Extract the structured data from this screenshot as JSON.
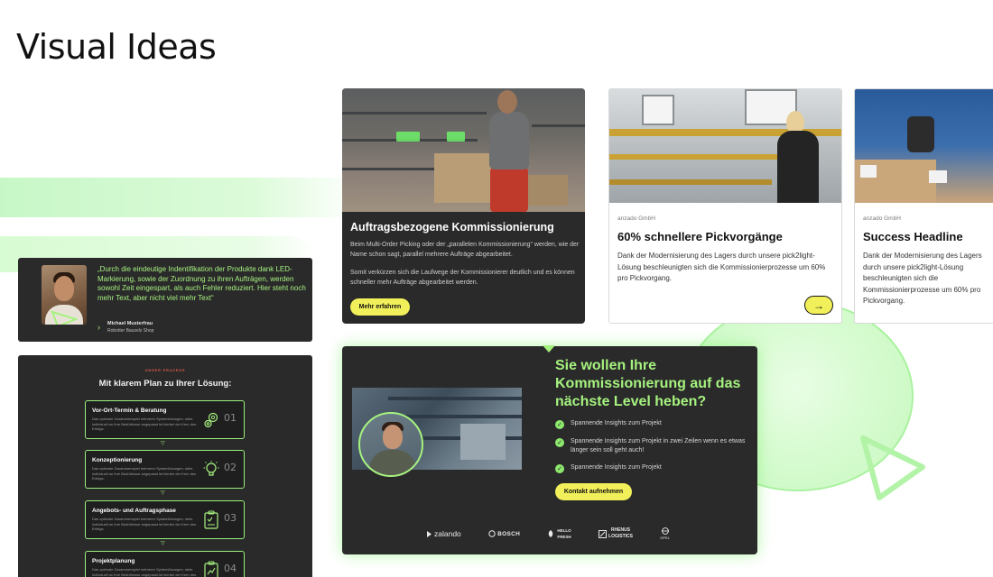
{
  "page": {
    "title": "Visual Ideas"
  },
  "testimonial": {
    "quote": "„Durch die eindeutige Indentifikation der Produkte dank LED-Markierung, sowie der Zuordnung zu ihren Aufträgen, werden sowohl Zeit eingespart, als auch Fehler reduziert. Hier steht noch mehr Text, aber nicht viel mehr Text“",
    "author_name": "Michael Musterfrau",
    "author_role": "Robotter Bauzelz Shop",
    "chevron": "›"
  },
  "process": {
    "eyebrow": "UNSER PROZESS",
    "title": "Mit klarem Plan zu Ihrer Lösung:",
    "arrow": "▽",
    "steps": [
      {
        "title": "Vor-Ort-Termin & Beratung",
        "desc": "Das optimale Zusammenspiel mehrerer Systemlösungen, stets individuell an Ihre Bedürfnisse angepasst ist hierbei der Kern des Erfolgs.",
        "number": "01",
        "icon": "gears-icon"
      },
      {
        "title": "Konzeptionierung",
        "desc": "Das optimale Zusammenspiel mehrerer Systemlösungen, stets individuell an Ihre Bedürfnisse angepasst ist hierbei der Kern des Erfolgs.",
        "number": "02",
        "icon": "lightbulb-icon"
      },
      {
        "title": "Angebots- und Auftragsphase",
        "desc": "Das optimale Zusammenspiel mehrerer Systemlösungen, stets individuell an Ihre Bedürfnisse angepasst ist hierbei der Kern des Erfolgs.",
        "number": "03",
        "icon": "clipboard-check-icon"
      },
      {
        "title": "Projektplanung",
        "desc": "Das optimale Zusammenspiel mehrerer Systemlösungen, stets individuell an Ihre Bedürfnisse angepasst ist hierbei der Kern des Erfolgs.",
        "number": "04",
        "icon": "clipboard-chart-icon"
      }
    ]
  },
  "card_dark": {
    "title": "Auftragsbezogene Kommissionierung",
    "paragraph1": "Beim Multi-Order Picking oder der „parallelen Kommissionierung“ werden, wie der Name schon sagt, parallel mehrere Aufträge abgearbeitet.",
    "paragraph2": "Somit verkürzen sich die Laufwege der Kommissionierer deutlich und es können schneller mehr Aufträge abgearbeitet werden.",
    "button": "Mehr erfahren"
  },
  "card_2": {
    "brand": "anzado GmbH",
    "title": "60% schnellere Pickvorgänge",
    "paragraph": "Dank der Modernisierung des Lagers durch unsere pick2light-Lösung beschleunigten sich die Kommissionierprozesse um 60% pro Pickvorgang.",
    "arrow": "→"
  },
  "card_3": {
    "brand": "anzado GmbH",
    "title": "Success Headline",
    "paragraph": "Dank der Modernisierung des Lagers durch unsere pick2light-Lösung beschleunigten sich die Kommissionierprozesse um 60% pro Pickvorgang."
  },
  "cta": {
    "headline": "Sie wollen Ihre Kommissionierung auf das nächste Level heben?",
    "checks": [
      "Spannende Insights zum Projekt",
      "Spannende Insights zum Projekt in zwei Zeilen wenn es etwas länger sein soll geht auch!",
      "Spannende Insights zum Projekt"
    ],
    "check_glyph": "✓",
    "button": "Kontakt aufnehmen",
    "logos": {
      "zalando": "zalando",
      "bosch": "BOSCH",
      "hellofresh_1": "HELLO",
      "hellofresh_2": "FRESH",
      "rhenus_1": "RHENUS",
      "rhenus_2": "LOGISTICS",
      "opel": "OPEL"
    }
  },
  "colors": {
    "accent_green": "#a6f27f",
    "button_yellow": "#f2f05a",
    "dark_panel": "#2a2a2a"
  }
}
